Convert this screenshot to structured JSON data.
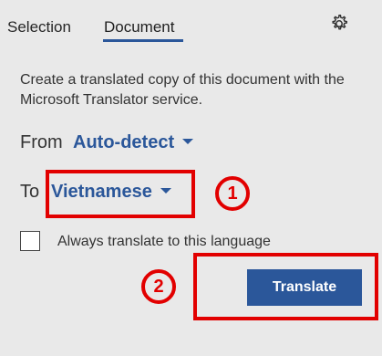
{
  "tabs": {
    "selection": "Selection",
    "document": "Document"
  },
  "description": "Create a translated copy of this document with the Microsoft Translator service.",
  "from": {
    "label": "From",
    "value": "Auto-detect"
  },
  "to": {
    "label": "To",
    "value": "Vietnamese"
  },
  "checkbox": {
    "label": "Always translate to this language",
    "checked": false
  },
  "translate_button": "Translate",
  "annotations": {
    "badge_1": "1",
    "badge_2": "2"
  },
  "colors": {
    "accent": "#2b579a",
    "annotation": "#e20000",
    "background": "#e9e9e9"
  },
  "icons": {
    "settings": "gear-icon"
  }
}
